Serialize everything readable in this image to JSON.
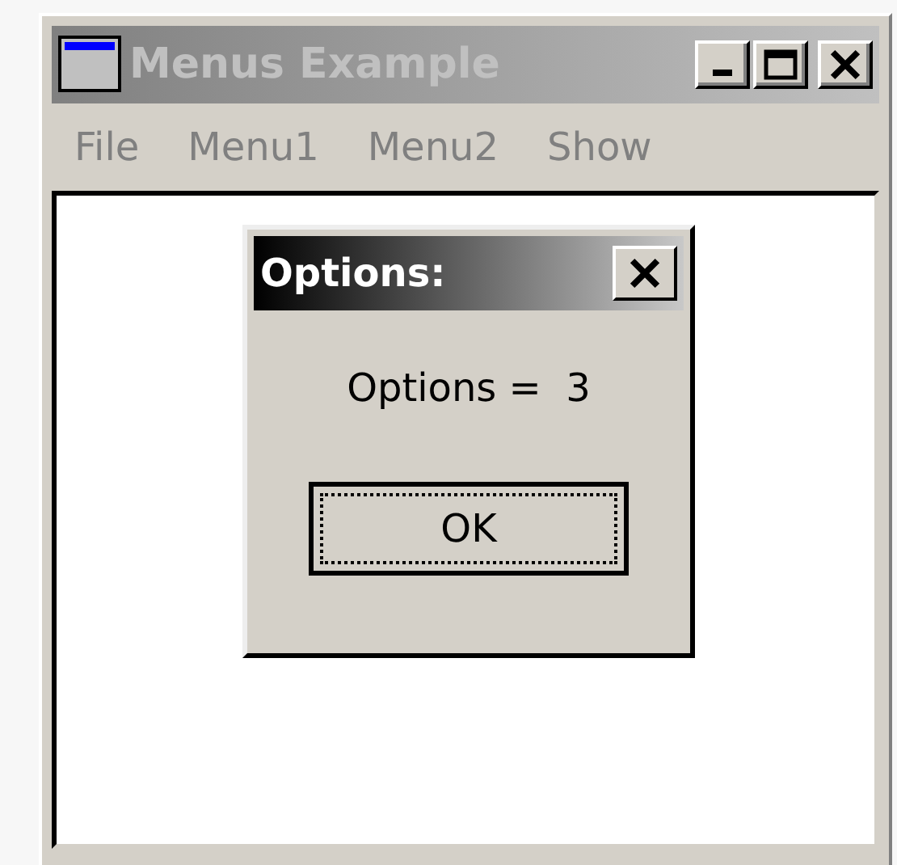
{
  "window": {
    "title": "Menus Example",
    "active": false
  },
  "menu": [
    {
      "label": "File",
      "disabled": true
    },
    {
      "label": "Menu1",
      "disabled": true
    },
    {
      "label": "Menu2",
      "disabled": true
    },
    {
      "label": "Show",
      "disabled": true
    }
  ],
  "dialog": {
    "title": "Options:",
    "active": true,
    "message": "Options =  3",
    "button": {
      "label": "OK",
      "focused": true
    }
  }
}
